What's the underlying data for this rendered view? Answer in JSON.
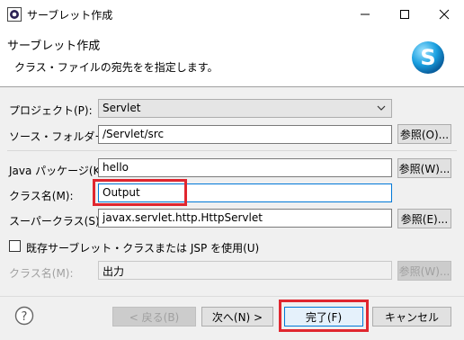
{
  "window": {
    "title": "サーブレット作成"
  },
  "header": {
    "title": "サーブレット作成",
    "description": "クラス・ファイルの宛先をを指定します。"
  },
  "form": {
    "project": {
      "label": "プロジェクト(P):",
      "value": "Servlet"
    },
    "source_folder": {
      "label": "ソース・フォルダー(D):",
      "value": "/Servlet/src",
      "browse": "参照(O)..."
    },
    "java_package": {
      "label": "Java パッケージ(K):",
      "value": "hello",
      "browse": "参照(W)..."
    },
    "class_name": {
      "label": "クラス名(M):",
      "value": "Output"
    },
    "superclass": {
      "label": "スーパークラス(S):",
      "value": "javax.servlet.http.HttpServlet",
      "browse": "参照(E)..."
    },
    "use_existing": {
      "label": "既存サーブレット・クラスまたは JSP を使用(U)",
      "checked": false
    },
    "existing_class": {
      "label": "クラス名(M):",
      "value": "出力",
      "browse": "参照(W)..."
    }
  },
  "footer": {
    "help": "?",
    "back": "< 戻る(B)",
    "next": "次へ(N) >",
    "finish": "完了(F)",
    "cancel": "キャンセル"
  },
  "colors": {
    "highlight": "#e0262f",
    "accent": "#0078d7"
  }
}
